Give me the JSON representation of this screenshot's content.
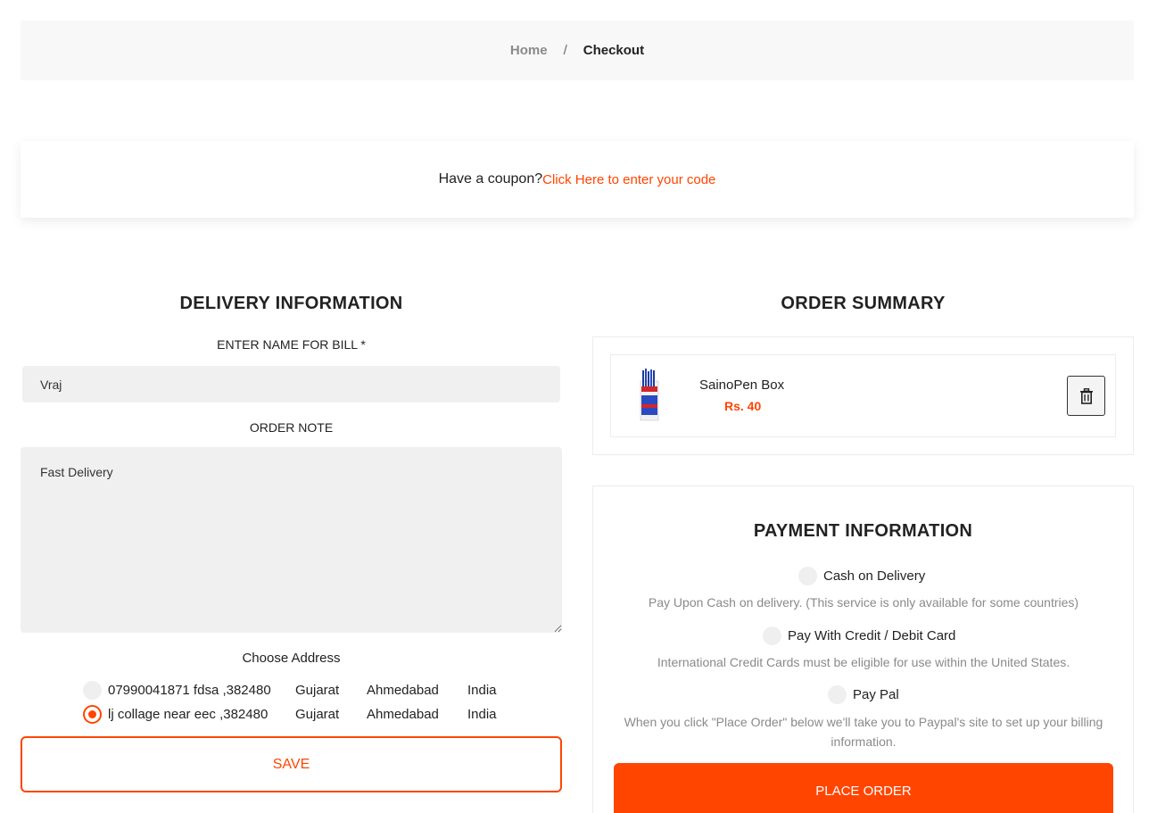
{
  "breadcrumb": {
    "home": "Home",
    "separator": "/",
    "current": "Checkout"
  },
  "coupon": {
    "question": "Have a coupon?",
    "link": "Click Here to enter your code"
  },
  "delivery": {
    "title": "DELIVERY INFORMATION",
    "name_label": "ENTER NAME FOR BILL *",
    "name_value": "Vraj",
    "note_label": "ORDER NOTE",
    "note_value": "Fast Delivery",
    "address_label": "Choose Address",
    "addresses": [
      {
        "line": "07990041871 fdsa ,382480",
        "state": "Gujarat",
        "city": "Ahmedabad",
        "country": "India",
        "selected": false
      },
      {
        "line": "lj collage near eec ,382480",
        "state": "Gujarat",
        "city": "Ahmedabad",
        "country": "India",
        "selected": true
      }
    ],
    "save_label": "SAVE"
  },
  "order_summary": {
    "title": "ORDER SUMMARY",
    "items": [
      {
        "name": "SainoPen Box",
        "price": "Rs. 40",
        "icon": "trash-icon"
      }
    ]
  },
  "payment": {
    "title": "PAYMENT INFORMATION",
    "options": [
      {
        "label": "Cash on Delivery",
        "description": "Pay Upon Cash on delivery. (This service is only available for some countries)"
      },
      {
        "label": "Pay With Credit / Debit Card",
        "description": "International Credit Cards must be eligible for use within the United States."
      },
      {
        "label": "Pay Pal",
        "description": "When you click \"Place Order\" below we'll take you to Paypal's site to set up your billing information."
      }
    ],
    "place_order_label": "PLACE ORDER"
  },
  "colors": {
    "accent": "#ff4500",
    "input_bg": "#f0f0f0"
  }
}
